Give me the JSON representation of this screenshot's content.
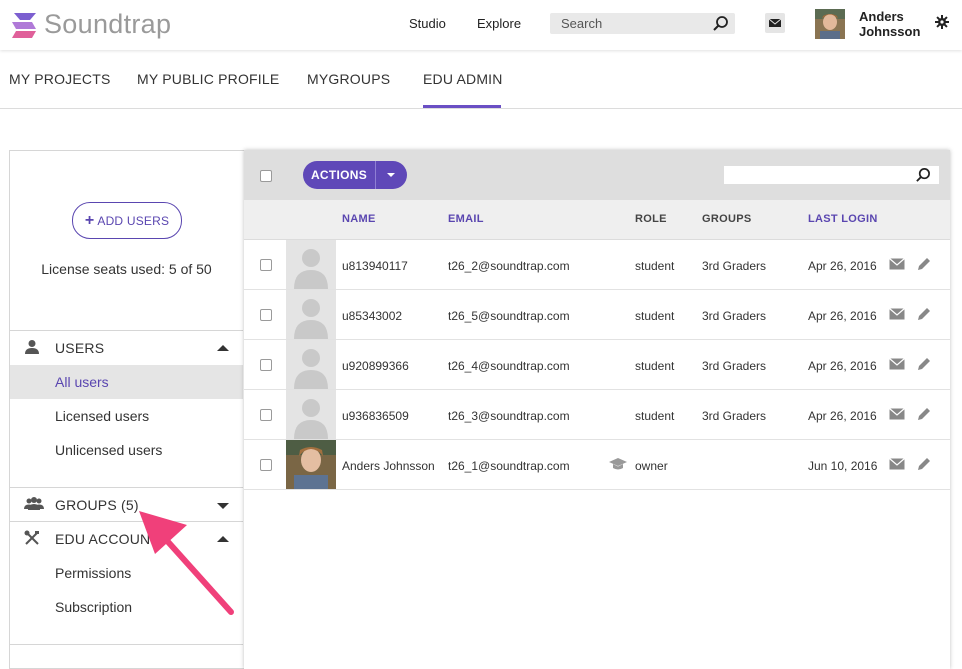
{
  "app": {
    "logo_text": "Soundtrap"
  },
  "topnav": {
    "links": [
      "Studio",
      "Explore"
    ],
    "search_placeholder": "Search",
    "user_first": "Anders",
    "user_last": "Johnsson"
  },
  "tabs": [
    {
      "label": "MY PROJECTS",
      "active": false
    },
    {
      "label": "MY PUBLIC PROFILE",
      "active": false
    },
    {
      "label": "MYGROUPS",
      "active": false
    },
    {
      "label": "EDU ADMIN",
      "active": true
    }
  ],
  "sidebar": {
    "add_users_label": "ADD USERS",
    "license_text": "License seats used: 5 of 50",
    "users_section": {
      "label": "USERS",
      "items": [
        {
          "label": "All users",
          "active": true
        },
        {
          "label": "Licensed users",
          "active": false
        },
        {
          "label": "Unlicensed users",
          "active": false
        }
      ]
    },
    "groups_section": {
      "label": "GROUPS (5)"
    },
    "edu_section": {
      "label": "EDU ACCOUN",
      "items": [
        {
          "label": "Permissions"
        },
        {
          "label": "Subscription"
        }
      ]
    }
  },
  "table": {
    "actions_label": "ACTIONS",
    "columns": {
      "name": "NAME",
      "email": "EMAIL",
      "role": "ROLE",
      "groups": "GROUPS",
      "last_login": "LAST LOGIN"
    },
    "rows": [
      {
        "name": "u813940117",
        "email": "t26_2@soundtrap.com",
        "role": "student",
        "groups": "3rd Graders",
        "last_login": "Apr 26, 2016",
        "photo": false
      },
      {
        "name": "u85343002",
        "email": "t26_5@soundtrap.com",
        "role": "student",
        "groups": "3rd Graders",
        "last_login": "Apr 26, 2016",
        "photo": false
      },
      {
        "name": "u920899366",
        "email": "t26_4@soundtrap.com",
        "role": "student",
        "groups": "3rd Graders",
        "last_login": "Apr 26, 2016",
        "photo": false
      },
      {
        "name": "u936836509",
        "email": "t26_3@soundtrap.com",
        "role": "student",
        "groups": "3rd Graders",
        "last_login": "Apr 26, 2016",
        "photo": false
      },
      {
        "name": "Anders Johnsson",
        "email": "t26_1@soundtrap.com",
        "role": "owner",
        "groups": "",
        "last_login": "Jun 10, 2016",
        "photo": true
      }
    ]
  },
  "colors": {
    "accent": "#5f48b8",
    "arrow": "#f0407a"
  }
}
